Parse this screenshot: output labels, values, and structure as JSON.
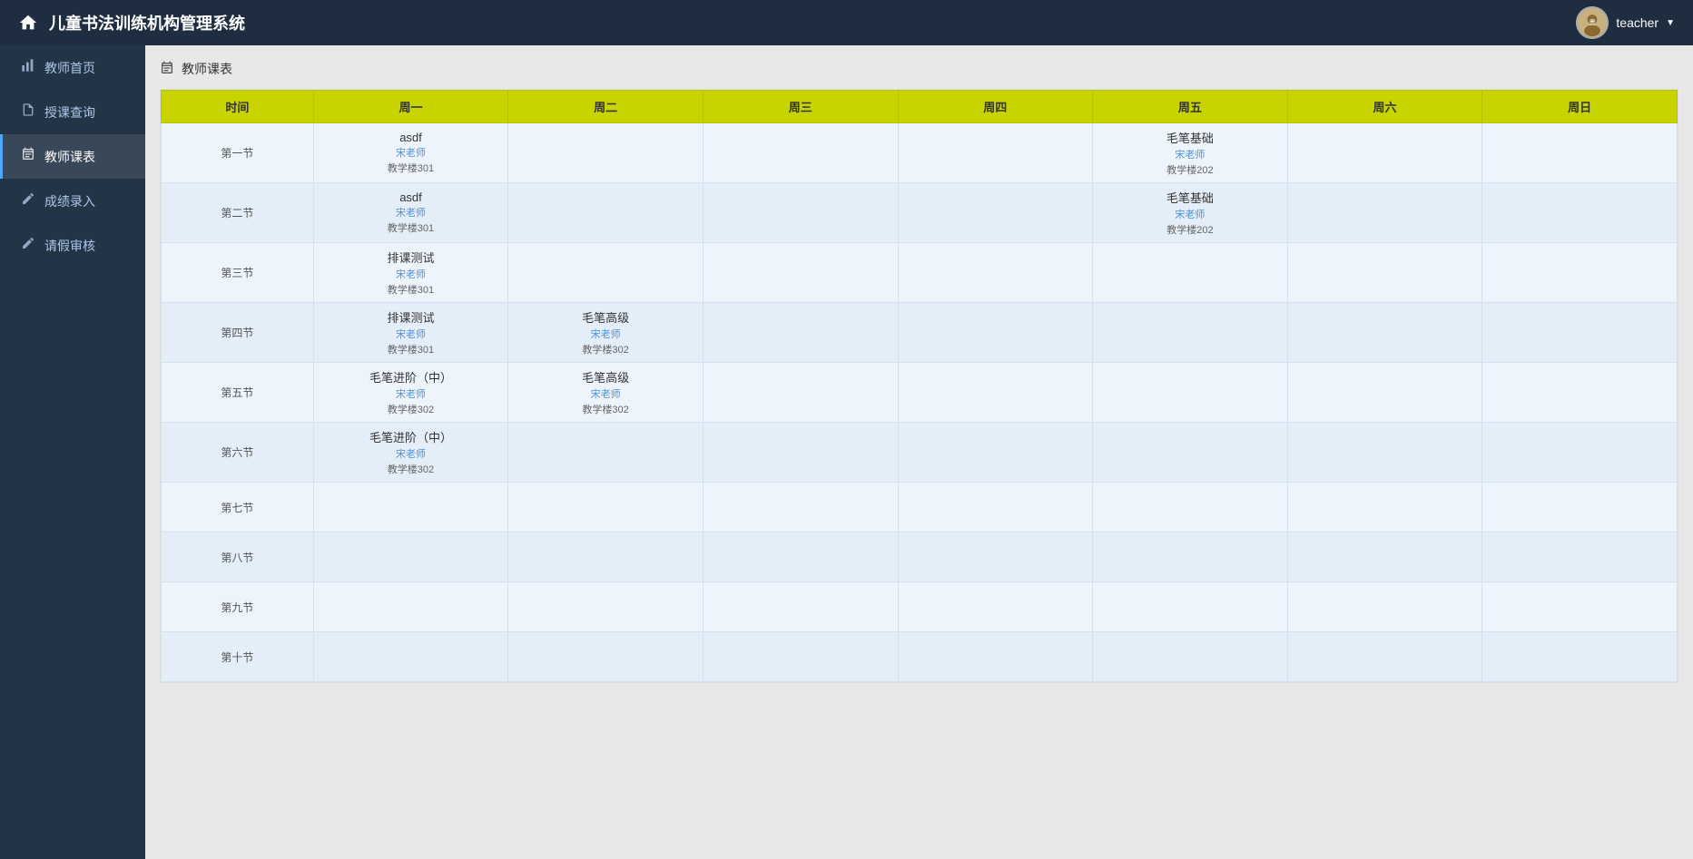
{
  "header": {
    "title": "儿童书法训练机构管理系统",
    "username": "teacher",
    "dropdown_arrow": "▼"
  },
  "sidebar": {
    "items": [
      {
        "id": "teacher-home",
        "label": "教师首页",
        "icon": "📊",
        "active": false
      },
      {
        "id": "course-query",
        "label": "授课查询",
        "icon": "📋",
        "active": false
      },
      {
        "id": "teacher-schedule",
        "label": "教师课表",
        "icon": "🗓",
        "active": true
      },
      {
        "id": "grade-entry",
        "label": "成绩录入",
        "icon": "✏️",
        "active": false
      },
      {
        "id": "leave-audit",
        "label": "请假审核",
        "icon": "✏️",
        "active": false
      }
    ]
  },
  "page": {
    "section_icon": "🗓",
    "section_title": "教师课表"
  },
  "schedule": {
    "columns": [
      "时间",
      "周一",
      "周二",
      "周三",
      "周四",
      "周五",
      "周六",
      "周日"
    ],
    "rows": [
      {
        "time": "第一节",
        "mon": {
          "title": "asdf",
          "teacher": "宋老师",
          "room": "教学楼301"
        },
        "tue": null,
        "wed": null,
        "thu": null,
        "fri": {
          "title": "毛笔基础",
          "teacher": "宋老师",
          "room": "教学楼202"
        },
        "sat": null,
        "sun": null
      },
      {
        "time": "第二节",
        "mon": {
          "title": "asdf",
          "teacher": "宋老师",
          "room": "教学楼301"
        },
        "tue": null,
        "wed": null,
        "thu": null,
        "fri": {
          "title": "毛笔基础",
          "teacher": "宋老师",
          "room": "教学楼202"
        },
        "sat": null,
        "sun": null
      },
      {
        "time": "第三节",
        "mon": {
          "title": "排课测试",
          "teacher": "宋老师",
          "room": "教学楼301"
        },
        "tue": null,
        "wed": null,
        "thu": null,
        "fri": null,
        "sat": null,
        "sun": null
      },
      {
        "time": "第四节",
        "mon": {
          "title": "排课测试",
          "teacher": "宋老师",
          "room": "教学楼301"
        },
        "tue": {
          "title": "毛笔高级",
          "teacher": "宋老师",
          "room": "教学楼302"
        },
        "wed": null,
        "thu": null,
        "fri": null,
        "sat": null,
        "sun": null
      },
      {
        "time": "第五节",
        "mon": {
          "title": "毛笔进阶（中）",
          "teacher": "宋老师",
          "room": "教学楼302"
        },
        "tue": {
          "title": "毛笔高级",
          "teacher": "宋老师",
          "room": "教学楼302"
        },
        "wed": null,
        "thu": null,
        "fri": null,
        "sat": null,
        "sun": null
      },
      {
        "time": "第六节",
        "mon": {
          "title": "毛笔进阶（中）",
          "teacher": "宋老师",
          "room": "教学楼302"
        },
        "tue": null,
        "wed": null,
        "thu": null,
        "fri": null,
        "sat": null,
        "sun": null
      },
      {
        "time": "第七节",
        "mon": null,
        "tue": null,
        "wed": null,
        "thu": null,
        "fri": null,
        "sat": null,
        "sun": null
      },
      {
        "time": "第八节",
        "mon": null,
        "tue": null,
        "wed": null,
        "thu": null,
        "fri": null,
        "sat": null,
        "sun": null
      },
      {
        "time": "第九节",
        "mon": null,
        "tue": null,
        "wed": null,
        "thu": null,
        "fri": null,
        "sat": null,
        "sun": null
      },
      {
        "time": "第十节",
        "mon": null,
        "tue": null,
        "wed": null,
        "thu": null,
        "fri": null,
        "sat": null,
        "sun": null
      }
    ]
  }
}
